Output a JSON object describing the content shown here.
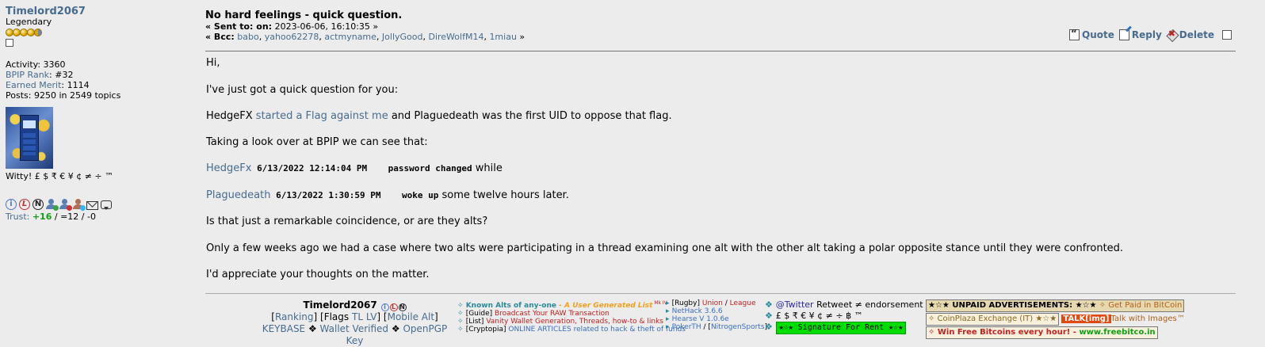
{
  "poster": {
    "username": "Timelord2067",
    "rank": "Legendary",
    "activity": "Activity: 3360",
    "bpip_rank_label": "BPIP Rank",
    "bpip_rank_value": ": #32",
    "merit_label": "Earned Merit",
    "merit_value": ": 1114",
    "posts": "Posts: 9250 in 2549 topics",
    "witty": "Witty! £ $ ₹ € ¥ ¢ ≠ ÷ ™",
    "trust_label": "Trust: ",
    "trust_pos": "+16",
    "trust_rest": " / =12 / -0",
    "stars_full": 4,
    "stars_half": 1
  },
  "post": {
    "subject": "No hard feelings - quick question.",
    "sent_label": "« Sent to: on:",
    "sent_date": " 2023-06-06, 16:10:35 »",
    "bcc_label": "« Bcc:",
    "bcc_users": [
      "babo",
      "yahoo62278",
      "actmyname",
      "JollyGood",
      "DireWolfM14",
      "1miau"
    ],
    "bcc_end": "»",
    "actions": {
      "quote": "Quote",
      "reply": "Reply",
      "delete": "Delete"
    }
  },
  "body": {
    "greeting": "Hi,",
    "line1": "I've just got a quick question for you:",
    "line2_pre": "HedgeFX ",
    "line2_link": "started a Flag against me",
    "line2_post": " and Plaguedeath was the first UID to oppose that flag.",
    "line3": "Taking a look over at BPIP we can see that:",
    "row1_user": "HedgeFx",
    "row1_time": " 6/13/2022 12:14:04 PM    password changed",
    "row1_tail": " while",
    "row2_user": "Plaguedeath",
    "row2_time": " 6/13/2022 1:30:59 PM    woke up",
    "row2_tail": " some twelve hours later.",
    "line4": "Is that just a remarkable coincidence, or are they alts?",
    "line5": "Only a few weeks ago we had a case where two alts were participating in a thread examining one alt with the other alt taking a polar opposite stance until they were confronted.",
    "line6": "I'd appreciate your thoughts on the matter."
  },
  "signature": {
    "name": "Timelord2067",
    "ranking": "Ranking",
    "flags": "[Flags ",
    "tl": "TL",
    "lv": "LV",
    "mobile": "Mobile Alt",
    "keybase": "KEYBASE",
    "wallet": "Wallet Verified",
    "openpgp": "OpenPGP Key",
    "col2": {
      "l1a": "Known Alts of any-one",
      "l1b": " - ",
      "l1c": "A User Generated List",
      "l1d": " Mk IV",
      "l2a": "[Guide] ",
      "l2b": "Broadcast Your RAW Transaction",
      "l3a": "[List] ",
      "l3b": "Vanity Wallet Generation, Threads, how-to & links",
      "l4a": "[Cryptopia] ",
      "l4b": "ONLINE ARTICLES related to hack & theft of funds"
    },
    "col3": {
      "l1a": "[Rugby] ",
      "l1b": "Union",
      "l1c": " / ",
      "l1d": "League",
      "l2": "NetHack 3.6.6",
      "l3": "Hearse V 1.0.6e",
      "l4a": "PokerTH",
      "l4b": " / [",
      "l4c": "NitrogenSports",
      "l4d": "]"
    },
    "col4": {
      "twitter": "@Twitter",
      "retweet": " Retweet ≠ endorsement",
      "currency": "£ $ ₹ € ¥ ¢ ≠ ÷ ฿ ™",
      "rent": "★☆★ Signature For Rent ★☆★"
    },
    "ads": {
      "unpaid": "★☆★ UNPAID ADVERTISEMENTS: ★☆★",
      "paid": " ✧ Get Paid in BitCoin",
      "coinplaza": "✧ CoinPlaza Exchange (IT) ★☆★",
      "talk": "TALK[img]",
      "talk_images": "Talk with Images™",
      "freebit": "✧ Win Free Bitcoins every hour! - ",
      "freebit_url": "www.freebitco.in"
    }
  }
}
